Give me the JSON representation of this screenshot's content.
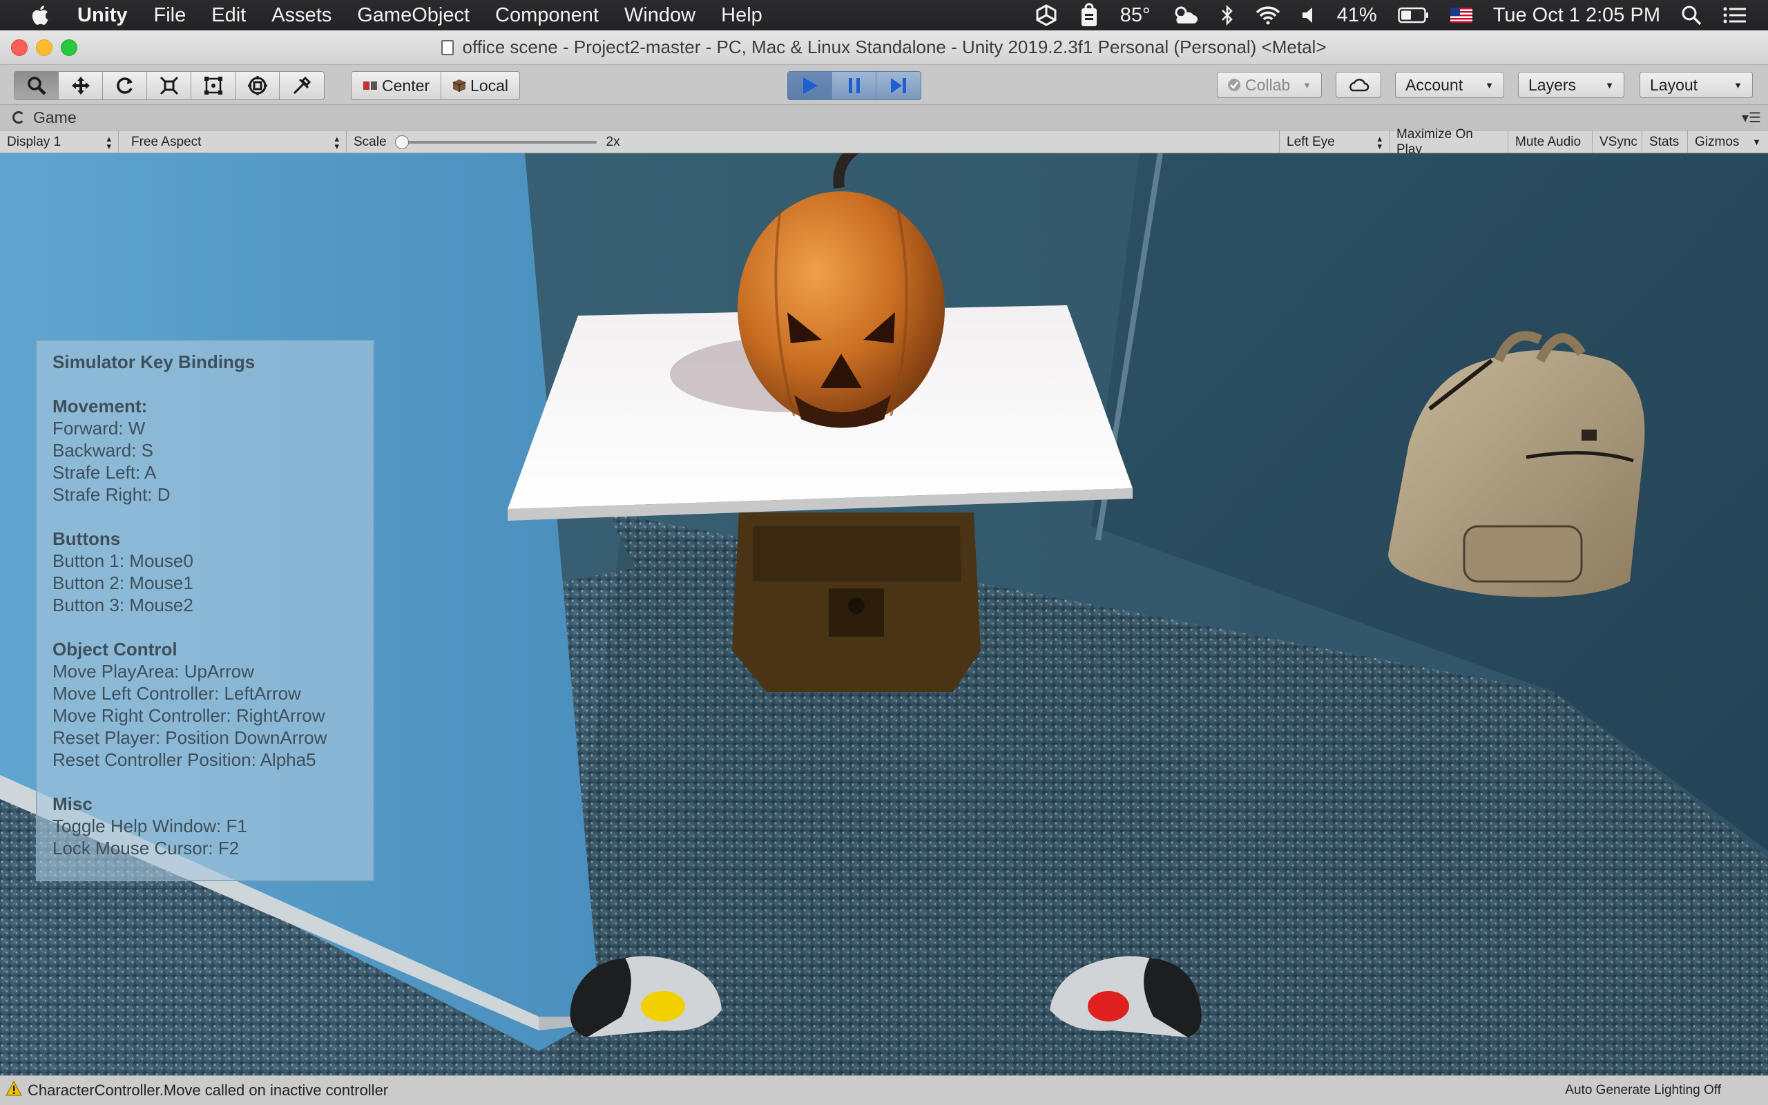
{
  "menubar": {
    "apple_icon": "apple-logo-icon",
    "app_name": "Unity",
    "items": [
      "File",
      "Edit",
      "Assets",
      "GameObject",
      "Component",
      "Window",
      "Help"
    ],
    "status": {
      "temperature": "85°",
      "battery": "41%",
      "datetime": "Tue Oct 1  2:05 PM"
    }
  },
  "window": {
    "title": "office scene - Project2-master - PC, Mac & Linux Standalone - Unity 2019.2.3f1 Personal (Personal) <Metal>"
  },
  "toolbar": {
    "tools": [
      "hand-tool-icon",
      "move-tool-icon",
      "rotate-tool-icon",
      "scale-tool-icon",
      "rect-tool-icon",
      "transform-tool-icon",
      "custom-tool-icon"
    ],
    "pivot_label": "Center",
    "space_label": "Local",
    "collab_label": "Collab",
    "account_label": "Account",
    "layers_label": "Layers",
    "layout_label": "Layout"
  },
  "game_tab": {
    "label": "Game"
  },
  "game_bar": {
    "display": "Display 1",
    "aspect": "Free Aspect",
    "scale_label": "Scale",
    "scale_value": "2x",
    "scale_fraction": 0.0,
    "eye": "Left Eye",
    "maximize": "Maximize On Play",
    "mute": "Mute Audio",
    "vsync": "VSync",
    "stats": "Stats",
    "gizmos": "Gizmos"
  },
  "help": {
    "title": "Simulator Key Bindings",
    "sections": [
      {
        "heading": "Movement:",
        "lines": [
          "Forward: W",
          "Backward: S",
          "Strafe Left: A",
          "Strafe Right: D"
        ]
      },
      {
        "heading": "Buttons",
        "lines": [
          "Button 1: Mouse0",
          "Button 2: Mouse1",
          "Button 3: Mouse2"
        ]
      },
      {
        "heading": "Object Control",
        "lines": [
          "Move PlayArea: UpArrow",
          "Move Left Controller: LeftArrow",
          "Move Right Controller: RightArrow",
          "Reset Player: Position DownArrow",
          "Reset Controller Position: Alpha5"
        ]
      },
      {
        "heading": "Misc",
        "lines": [
          "Toggle Help Window: F1",
          "Lock Mouse Cursor: F2"
        ]
      }
    ]
  },
  "status": {
    "message": "CharacterController.Move called on inactive controller",
    "lighting": "Auto Generate Lighting Off"
  }
}
